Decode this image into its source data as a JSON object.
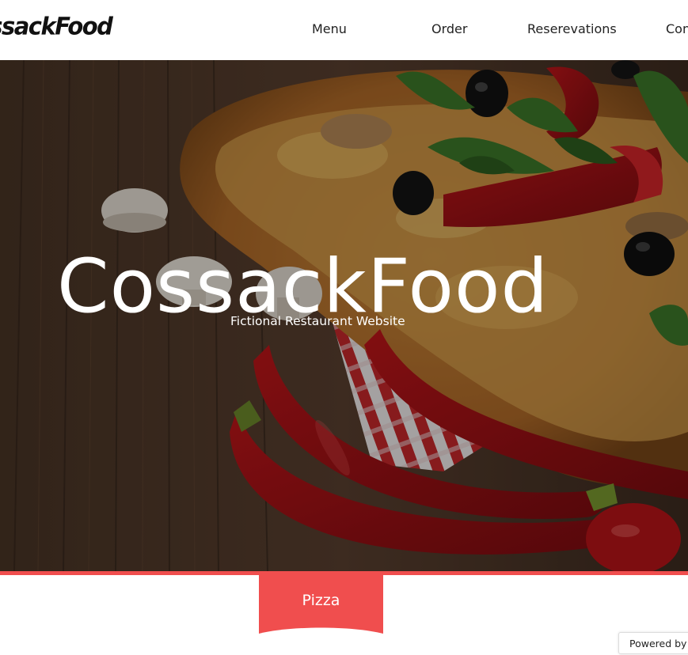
{
  "header": {
    "logo": "CossackFood",
    "nav": {
      "menu": "Menu",
      "order": "Order",
      "reservations": "Reserevations",
      "contact": "Contact"
    }
  },
  "hero": {
    "title": "CossackFood",
    "subtitle": "Fictional Restaurant Website"
  },
  "tabs": {
    "pizza": "Pizza"
  },
  "badge": {
    "powered": "Powered by"
  },
  "colors": {
    "accent": "#f04e4e",
    "nav_text": "#222222",
    "hero_text": "#ffffff"
  }
}
